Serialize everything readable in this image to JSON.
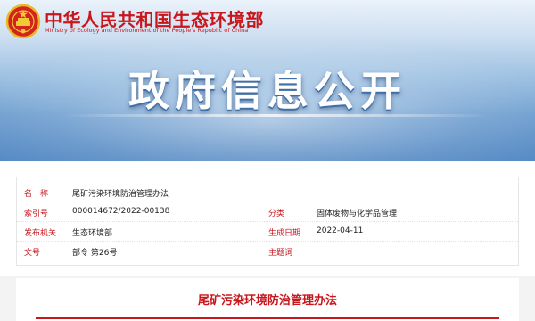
{
  "header": {
    "ministry_name": "中华人民共和国生态环境部",
    "ministry_name_en": "Ministry of Ecology and Environment of the People's Republic of China",
    "banner_title": "政府信息公开"
  },
  "meta": {
    "name_label": "名　称",
    "name_value": "尾矿污染环境防治管理办法",
    "index_label": "索引号",
    "index_value": "000014672/2022-00138",
    "category_label": "分类",
    "category_value": "固体废物与化学品管理",
    "issuer_label": "发布机关",
    "issuer_value": "生态环境部",
    "date_label": "生成日期",
    "date_value": "2022-04-11",
    "doc_no_label": "文号",
    "doc_no_value": "部令 第26号",
    "subject_label": "主题词",
    "subject_value": ""
  },
  "document": {
    "title": "尾矿污染环境防治管理办法"
  },
  "colors": {
    "brand_red": "#c8161d",
    "banner_blue": "#6f9fd0"
  }
}
